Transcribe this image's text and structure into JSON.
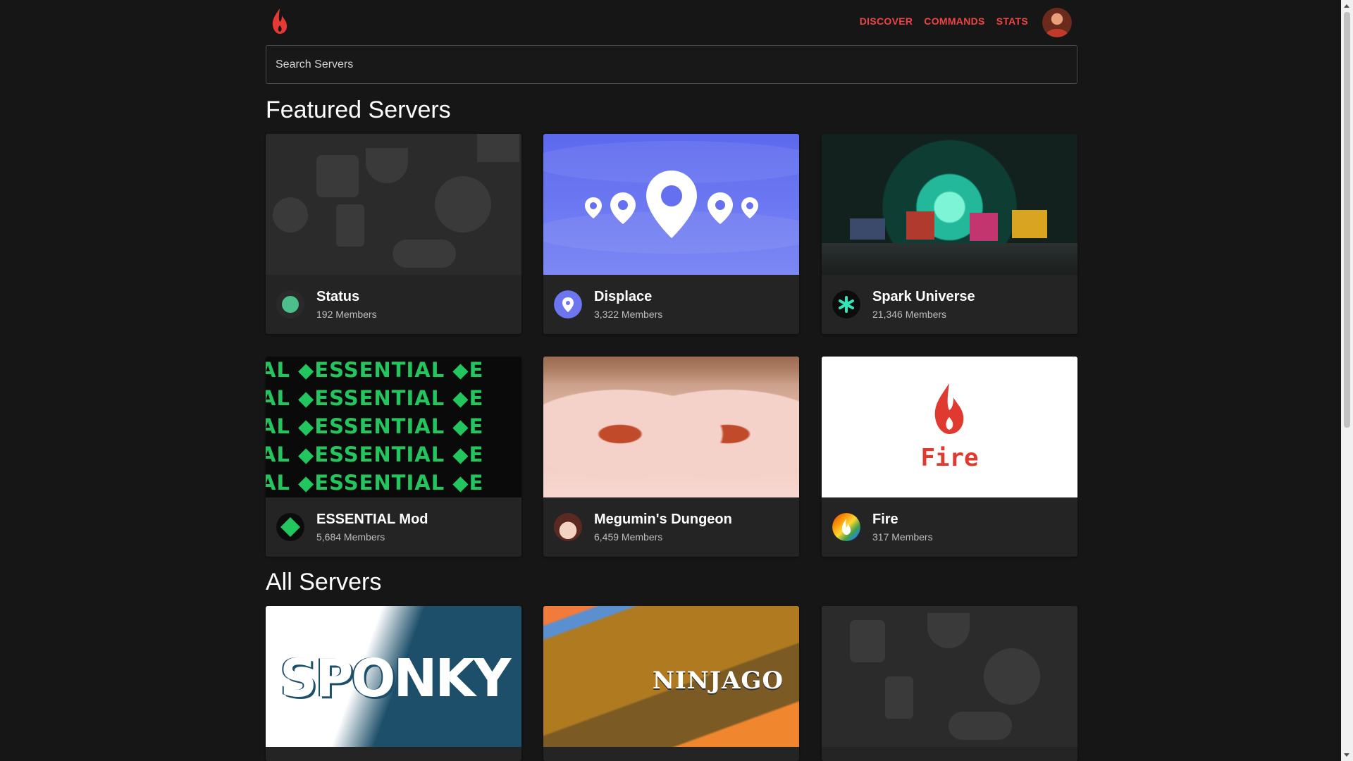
{
  "nav": {
    "items": [
      "DISCOVER",
      "COMMANDS",
      "STATS"
    ],
    "accent_color": "#ef4444"
  },
  "search": {
    "placeholder": "Search Servers"
  },
  "sections": {
    "featured_title": "Featured Servers",
    "all_title": "All Servers"
  },
  "featured": [
    {
      "name": "Status",
      "members": "192 Members"
    },
    {
      "name": "Displace",
      "members": "3,322 Members"
    },
    {
      "name": "Spark Universe",
      "members": "21,346 Members"
    },
    {
      "name": "ESSENTIAL Mod",
      "members": "5,684 Members"
    },
    {
      "name": "Megumin's Dungeon",
      "members": "6,459 Members"
    },
    {
      "name": "Fire",
      "members": "317 Members"
    }
  ],
  "banner_text": {
    "essential": "AL ◆ESSENTIAL ◆E",
    "fire": "Fire",
    "sponky": "SPONKY",
    "ninjago": "NINJAGO"
  },
  "icons": {
    "logo": "flame-icon",
    "avatar": "user-avatar"
  }
}
